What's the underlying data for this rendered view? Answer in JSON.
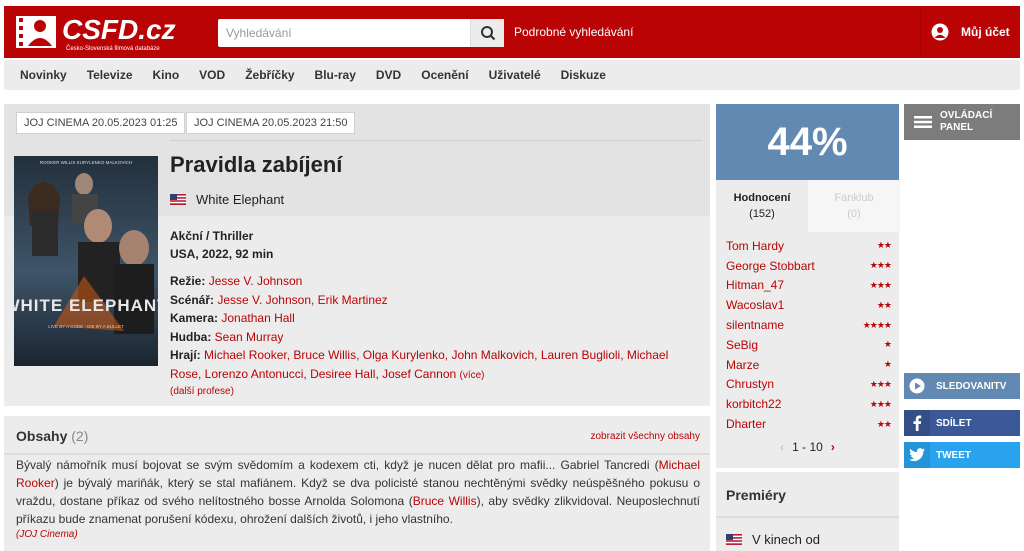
{
  "header": {
    "logo_text": "CSFD.cz",
    "logo_subtitle": "Česko-Slovenská filmová databáze",
    "search_placeholder": "Vyhledávání",
    "advanced_search": "Podrobné vyhledávání",
    "account": "Můj účet"
  },
  "nav": [
    "Novinky",
    "Televize",
    "Kino",
    "VOD",
    "Žebříčky",
    "Blu-ray",
    "DVD",
    "Ocenění",
    "Uživatelé",
    "Diskuze"
  ],
  "tv_tags": [
    "JOJ CINEMA 20.05.2023 01:25",
    "JOJ CINEMA 20.05.2023 21:50"
  ],
  "film": {
    "title": "Pravidla zabíjení",
    "original_title": "White Elephant",
    "genre": "Akční / Thriller",
    "origin": "USA, 2022, 92 min",
    "poster_title": "WHITE ELEPHANT",
    "poster_tagline": "LIVE BY A CODE · DIE BY A BULLET",
    "poster_names": "ROOKER   WILLIS   KURYLENKO   MALKOVICH",
    "directing_label": "Režie:",
    "directing": "Jesse V. Johnson",
    "screenplay_label": "Scénář:",
    "screenplay": "Jesse V. Johnson, Erik Martinez",
    "camera_label": "Kamera:",
    "camera": "Jonathan Hall",
    "music_label": "Hudba:",
    "music": "Sean Murray",
    "cast_label": "Hrají:",
    "cast": "Michael Rooker, Bruce Willis, Olga Kurylenko, John Malkovich, Lauren Buglioli, Michael Rose, Lorenzo Antonucci, Desiree Hall, Josef Cannon",
    "cast_more": "(více)",
    "more_professions": "(další profese)"
  },
  "plots": {
    "heading": "Obsahy",
    "count": "(2)",
    "show_all": "zobrazit všechny obsahy",
    "text_1": "Bývalý námořník musí bojovat se svým svědomím a kodexem cti, když je nucen dělat pro mafii... Gabriel Tancredi (",
    "link_1": "Michael Rooker",
    "text_2": ") je bývalý mariňák, který se stal mafiánem. Když se dva policisté stanou nechtěnými svědky neúspěšného pokusu o vraždu, dostane příkaz od svého nelítostného bosse Arnolda Solomona (",
    "link_2": "Bruce Willis",
    "text_3": "), aby svědky zlikvidoval. Neuposlechnutí příkazu bude znamenat porušení kódexu, ohrožení dalších životů, i jeho vlastního.",
    "source": "(JOJ Cinema)"
  },
  "rating": {
    "percent": "44%",
    "tab_ratings": "Hodnocení",
    "tab_ratings_count": "(152)",
    "tab_fanclub": "Fanklub",
    "tab_fanclub_count": "(0)",
    "users": [
      {
        "name": "Tom Hardy",
        "stars": "★★"
      },
      {
        "name": "George Stobbart",
        "stars": "★★★"
      },
      {
        "name": "Hitman_47",
        "stars": "★★★"
      },
      {
        "name": "Wacoslav1",
        "stars": "★★"
      },
      {
        "name": "silentname",
        "stars": "★★★★"
      },
      {
        "name": "SeBig",
        "stars": "★"
      },
      {
        "name": "Marze",
        "stars": "★"
      },
      {
        "name": "Chrustyn",
        "stars": "★★★"
      },
      {
        "name": "korbitch22",
        "stars": "★★★"
      },
      {
        "name": "Dharter",
        "stars": "★★"
      }
    ],
    "pager": "1 - 10"
  },
  "premiery": {
    "heading": "Premiéry",
    "row": "V kinech od"
  },
  "side": {
    "panel_line1": "OVLÁDACÍ",
    "panel_line2": "PANEL",
    "watch": "SLEDOVANITV",
    "share": "SDÍLET",
    "tweet": "TWEET"
  },
  "colors": {
    "brand_red": "#ba0305",
    "rating_blue": "#6189b2",
    "facebook": "#3b5998",
    "twitter": "#2aa3ef",
    "watch": "#6189b2"
  }
}
